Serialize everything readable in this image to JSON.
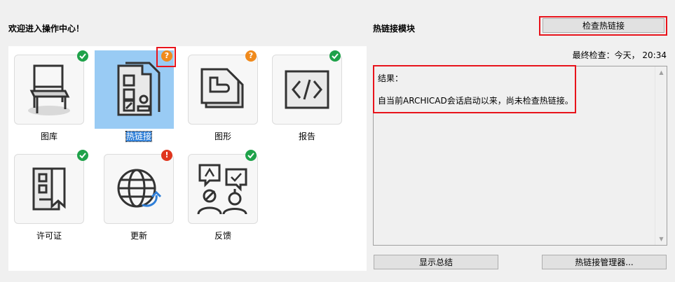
{
  "welcome_text": "欢迎进入操作中心！",
  "tiles": [
    {
      "label": "图库",
      "status": "ok"
    },
    {
      "label": "热链接",
      "status": "warn",
      "selected": true
    },
    {
      "label": "图形",
      "status": "warn"
    },
    {
      "label": "报告",
      "status": "ok"
    },
    {
      "label": "许可证",
      "status": "ok"
    },
    {
      "label": "更新",
      "status": "err"
    },
    {
      "label": "反馈",
      "status": "ok"
    }
  ],
  "badge_text": {
    "warn": "?",
    "err": "!"
  },
  "hotlink": {
    "title": "热链接模块",
    "check_button": "检查热链接",
    "last_check": "最终检查：今天， 20:34",
    "results_heading": "结果：",
    "results_message": "自当前ARCHICAD会话启动以来，尚未检查热链接。",
    "summary_button": "显示总结",
    "manager_button": "热链接管理器..."
  },
  "colors": {
    "ok": "#1fa24a",
    "warn": "#f08a1c",
    "err": "#e0361e",
    "selection": "#99cbf4",
    "highlight": "#e8131b"
  }
}
